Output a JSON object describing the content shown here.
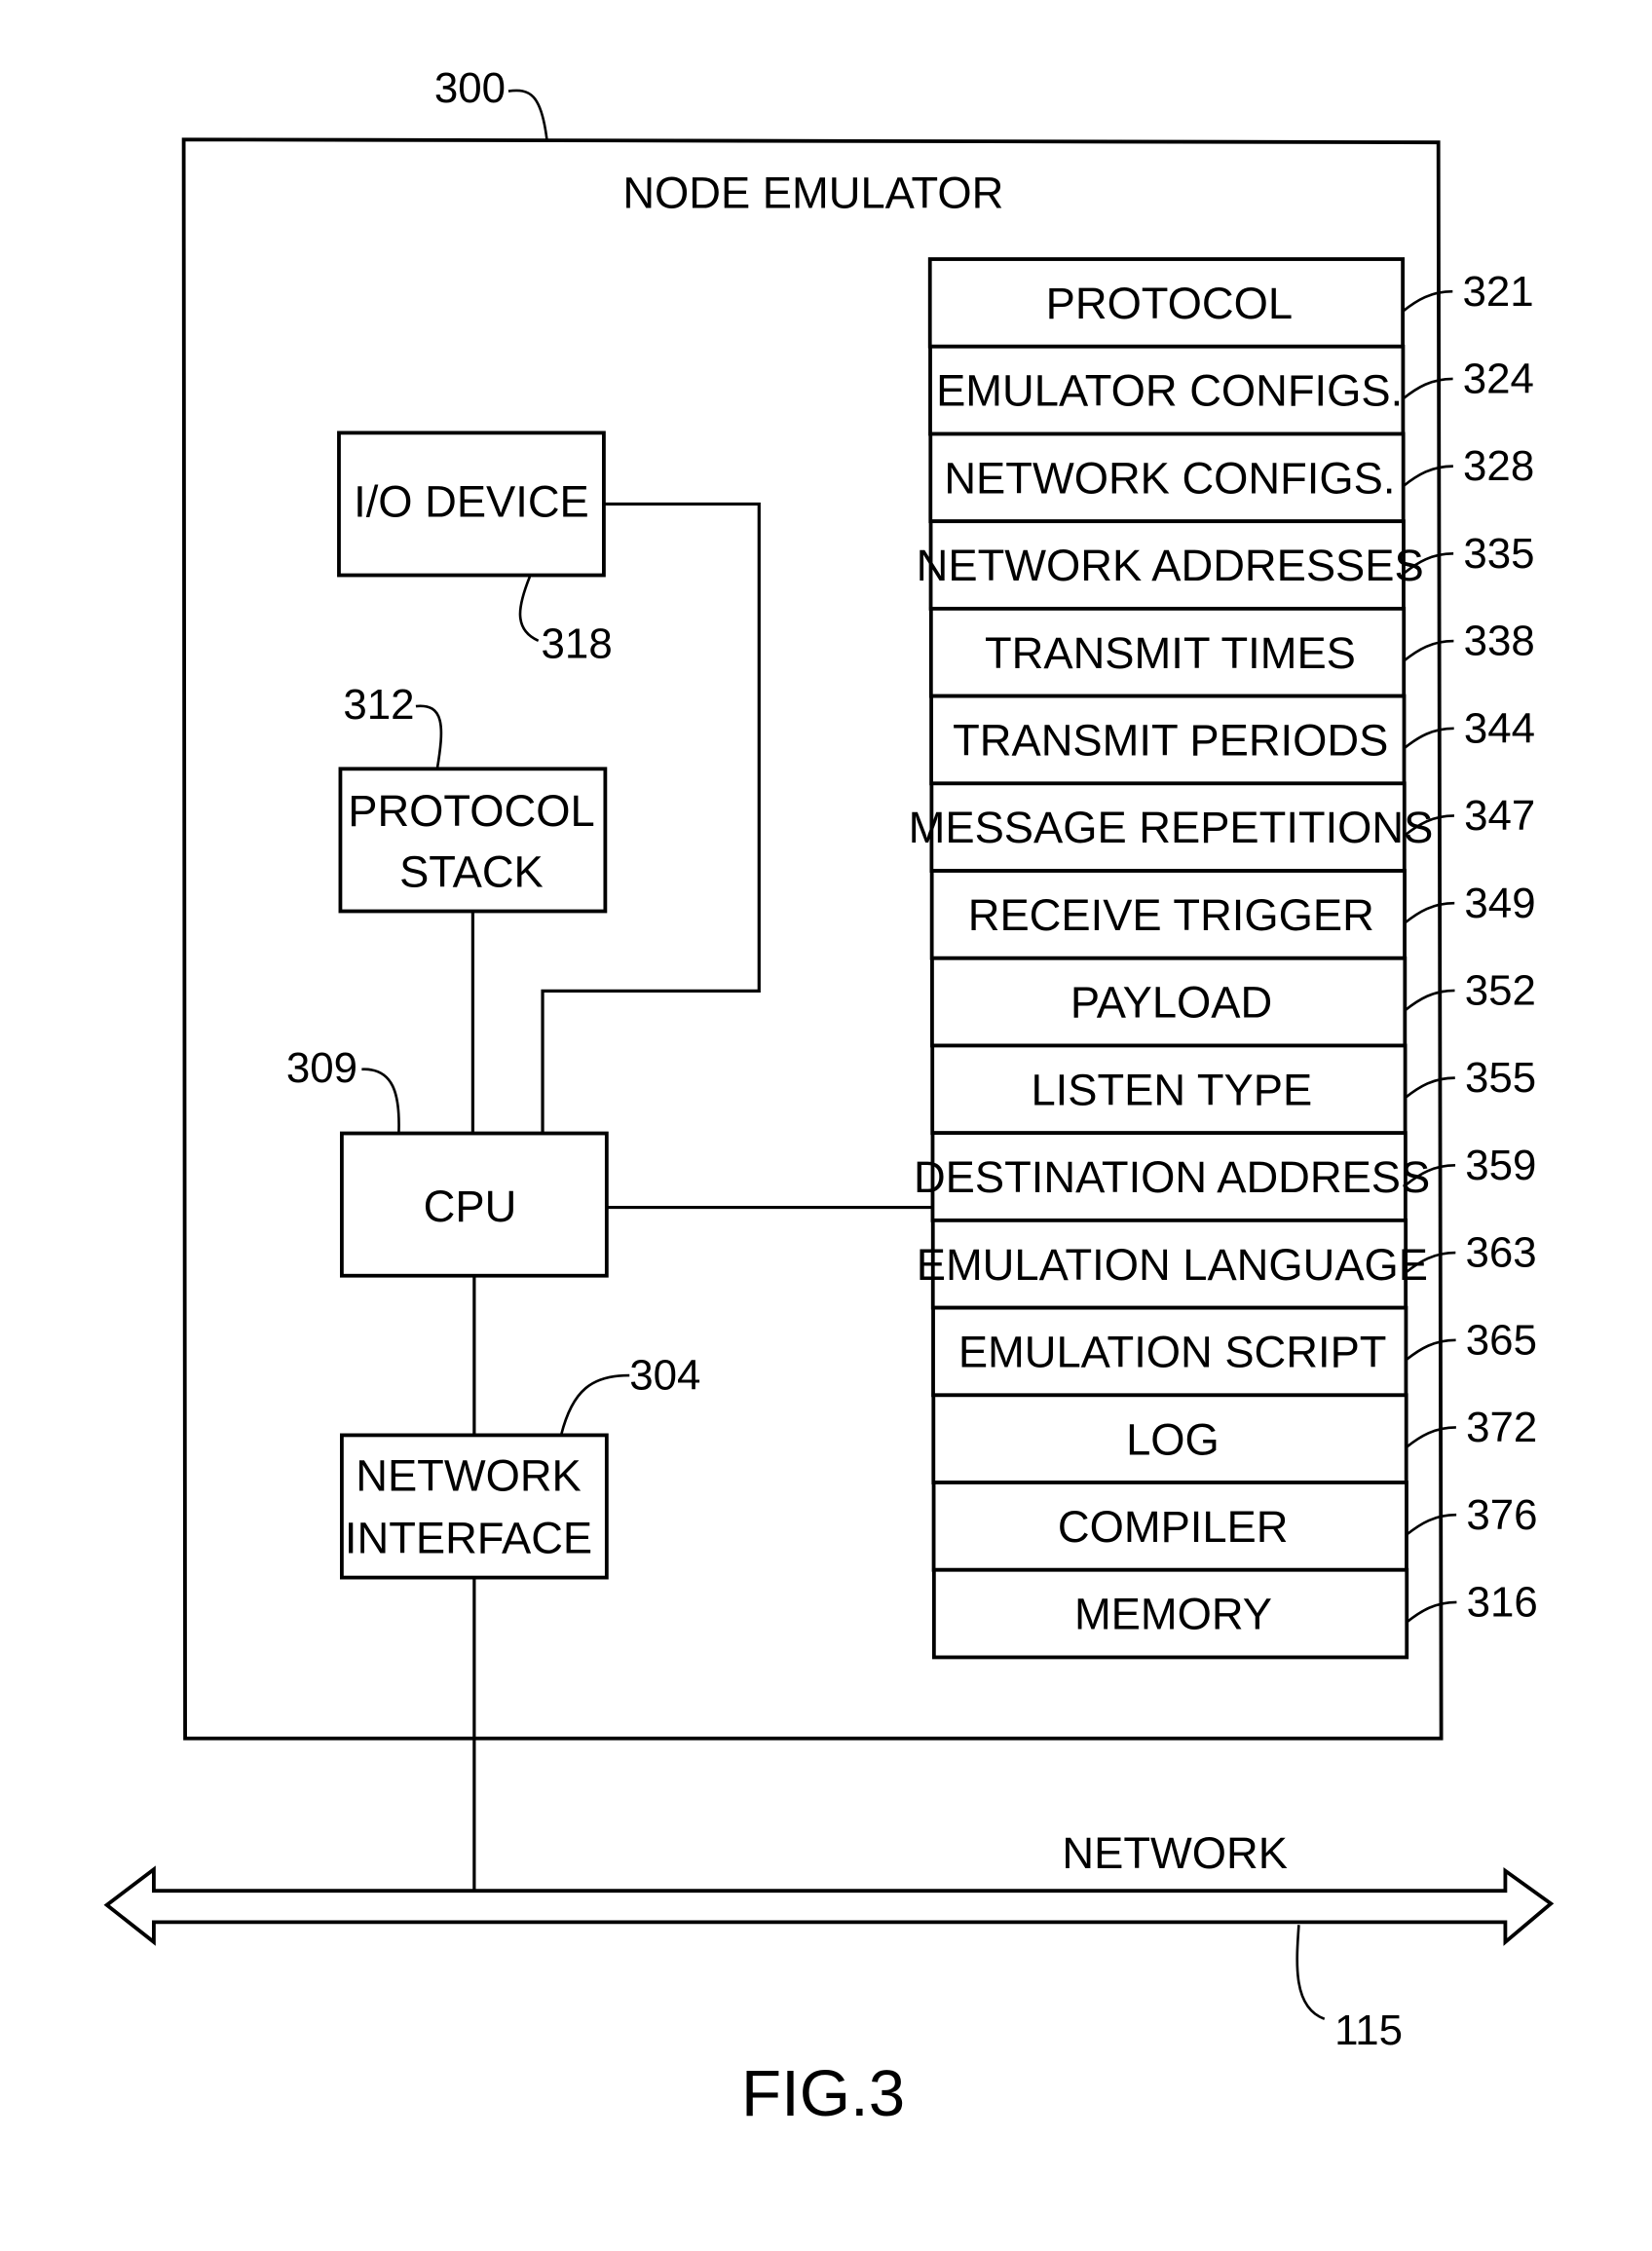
{
  "figure": {
    "label": "FIG.3",
    "outer": {
      "title": "NODE EMULATOR",
      "ref": "300"
    },
    "left_blocks": [
      {
        "id": "io",
        "lines": [
          "I/O DEVICE"
        ],
        "ref": "318"
      },
      {
        "id": "stack",
        "lines": [
          "PROTOCOL",
          "STACK"
        ],
        "ref": "312"
      },
      {
        "id": "cpu",
        "lines": [
          "CPU"
        ],
        "ref": "309"
      },
      {
        "id": "netif",
        "lines": [
          "NETWORK",
          "INTERFACE"
        ],
        "ref": "304"
      }
    ],
    "memory_rows": [
      {
        "label": "PROTOCOL",
        "ref": "321"
      },
      {
        "label": "EMULATOR CONFIGS.",
        "ref": "324"
      },
      {
        "label": "NETWORK CONFIGS.",
        "ref": "328"
      },
      {
        "label": "NETWORK ADDRESSES",
        "ref": "335"
      },
      {
        "label": "TRANSMIT TIMES",
        "ref": "338"
      },
      {
        "label": "TRANSMIT PERIODS",
        "ref": "344"
      },
      {
        "label": "MESSAGE REPETITIONS",
        "ref": "347"
      },
      {
        "label": "RECEIVE TRIGGER",
        "ref": "349"
      },
      {
        "label": "PAYLOAD",
        "ref": "352"
      },
      {
        "label": "LISTEN TYPE",
        "ref": "355"
      },
      {
        "label": "DESTINATION ADDRESS",
        "ref": "359"
      },
      {
        "label": "EMULATION LANGUAGE",
        "ref": "363"
      },
      {
        "label": "EMULATION SCRIPT",
        "ref": "365"
      },
      {
        "label": "LOG",
        "ref": "372"
      },
      {
        "label": "COMPILER",
        "ref": "376"
      },
      {
        "label": "MEMORY",
        "ref": "316"
      }
    ],
    "network": {
      "label": "NETWORK",
      "ref": "115"
    }
  }
}
